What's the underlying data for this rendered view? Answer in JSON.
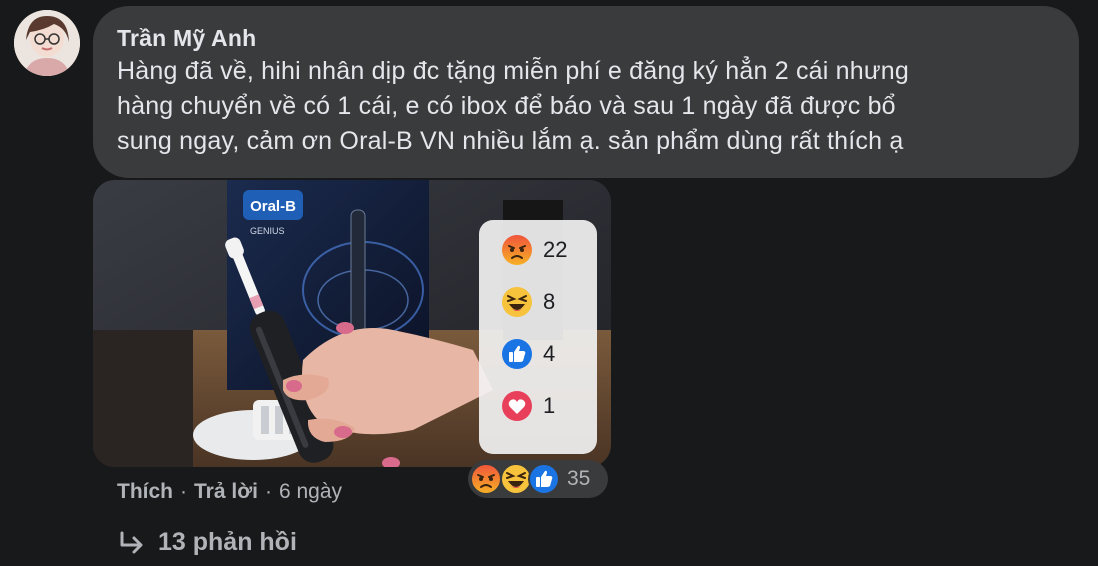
{
  "comment": {
    "author": "Trần Mỹ Anh",
    "text_lines": [
      "Hàng đã về, hihi nhân dịp đc tặng miễn phí e đăng ký hẳn 2 cái nhưng",
      "hàng chuyển về có 1 cái, e có ibox để báo và sau 1 ngày đã được bổ",
      "sung ngay, cảm ơn Oral-B VN nhiều lắm ạ. sản phẩm dùng rất thích ạ"
    ]
  },
  "photo": {
    "brand_text": "Oral-B",
    "model_text": "GENIUS"
  },
  "reaction_breakdown": [
    {
      "type": "angry-icon",
      "count": "22"
    },
    {
      "type": "haha-icon",
      "count": "8"
    },
    {
      "type": "like-icon",
      "count": "4"
    },
    {
      "type": "love-icon",
      "count": "1"
    }
  ],
  "actions": {
    "like": "Thích",
    "reply": "Trả lời",
    "time": "6 ngày",
    "separator": "·"
  },
  "reaction_summary": {
    "total": "35"
  },
  "replies": {
    "label": "13 phản hồi"
  },
  "colors": {
    "background": "#18191a",
    "bubble": "#3a3b3c",
    "text": "#e4e6eb",
    "secondary": "#b0b3b8"
  }
}
